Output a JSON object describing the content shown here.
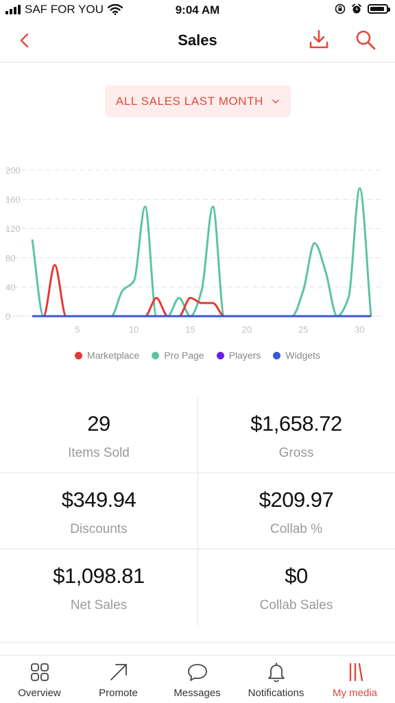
{
  "status_bar": {
    "carrier": "SAF FOR YOU",
    "time": "9:04 AM",
    "battery_level": 0.9
  },
  "header": {
    "title": "Sales"
  },
  "filter": {
    "label": "ALL SALES LAST MONTH"
  },
  "colors": {
    "accent": "#e0483a",
    "marketplace": "#e53935",
    "pro_page": "#5cc3a2",
    "players": "#6a1fe0",
    "widgets": "#3a56d9"
  },
  "chart_data": {
    "type": "line",
    "title": "",
    "xlabel": "",
    "ylabel": "",
    "ylim": [
      0,
      200
    ],
    "xlim": [
      1,
      31
    ],
    "y_ticks": [
      0,
      40,
      80,
      120,
      160,
      200
    ],
    "x_ticks": [
      5,
      10,
      15,
      20,
      25,
      30
    ],
    "grid": true,
    "legend_position": "bottom",
    "x": [
      1,
      2,
      3,
      4,
      5,
      6,
      7,
      8,
      9,
      10,
      11,
      12,
      13,
      14,
      15,
      16,
      17,
      18,
      19,
      20,
      21,
      22,
      23,
      24,
      25,
      26,
      27,
      28,
      29,
      30,
      31
    ],
    "series": [
      {
        "name": "Marketplace",
        "color": "#e53935",
        "values": [
          0,
          0,
          70,
          0,
          0,
          0,
          0,
          0,
          0,
          0,
          0,
          25,
          0,
          0,
          25,
          18,
          18,
          0,
          0,
          0,
          0,
          0,
          0,
          0,
          0,
          0,
          0,
          0,
          0,
          0,
          0
        ]
      },
      {
        "name": "Pro Page",
        "color": "#5cc3a2",
        "values": [
          105,
          0,
          0,
          0,
          0,
          0,
          0,
          0,
          35,
          48,
          150,
          0,
          0,
          25,
          0,
          35,
          150,
          0,
          0,
          0,
          0,
          0,
          0,
          0,
          35,
          100,
          60,
          0,
          25,
          175,
          0
        ]
      },
      {
        "name": "Players",
        "color": "#6a1fe0",
        "values": [
          0,
          0,
          0,
          0,
          0,
          0,
          0,
          0,
          0,
          0,
          0,
          0,
          0,
          0,
          0,
          0,
          0,
          0,
          0,
          0,
          0,
          0,
          0,
          0,
          0,
          0,
          0,
          0,
          0,
          0,
          0
        ]
      },
      {
        "name": "Widgets",
        "color": "#3a56d9",
        "values": [
          0,
          0,
          0,
          0,
          0,
          0,
          0,
          0,
          0,
          0,
          0,
          0,
          0,
          0,
          0,
          0,
          0,
          0,
          0,
          0,
          0,
          0,
          0,
          0,
          0,
          0,
          0,
          0,
          0,
          0,
          0
        ]
      }
    ]
  },
  "stats": [
    {
      "value": "29",
      "label": "Items Sold"
    },
    {
      "value": "$1,658.72",
      "label": "Gross"
    },
    {
      "value": "$349.94",
      "label": "Discounts"
    },
    {
      "value": "$209.97",
      "label": "Collab %"
    },
    {
      "value": "$1,098.81",
      "label": "Net Sales"
    },
    {
      "value": "$0",
      "label": "Collab Sales"
    }
  ],
  "tabs": [
    {
      "label": "Overview",
      "icon": "grid-icon"
    },
    {
      "label": "Promote",
      "icon": "arrow-up-right-icon"
    },
    {
      "label": "Messages",
      "icon": "chat-bubble-icon"
    },
    {
      "label": "Notifications",
      "icon": "bell-icon"
    },
    {
      "label": "My media",
      "icon": "media-bars-icon",
      "active": true
    }
  ]
}
